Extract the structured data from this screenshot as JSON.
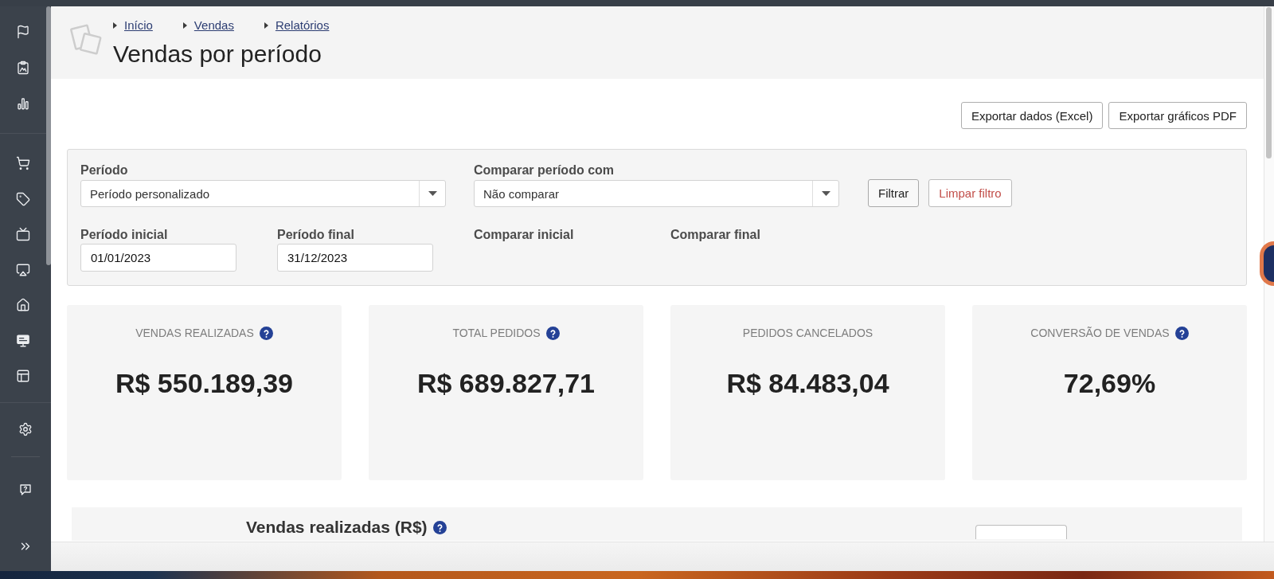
{
  "breadcrumbs": [
    {
      "label": "Início"
    },
    {
      "label": "Vendas"
    },
    {
      "label": "Relatórios"
    }
  ],
  "page": {
    "title": "Vendas por período"
  },
  "actions": [
    {
      "label": "Exportar dados (Excel)"
    },
    {
      "label": "Exportar gráficos PDF"
    }
  ],
  "filters": {
    "selects": [
      {
        "label": "Período",
        "value": "Período personalizado"
      },
      {
        "label": "Comparar período com",
        "value": "Não comparar"
      }
    ],
    "buttons": [
      {
        "label": "Filtrar",
        "kind": "default"
      },
      {
        "label": "Limpar filtro",
        "kind": "danger"
      }
    ],
    "dates": [
      {
        "label": "Período inicial",
        "value": "01/01/2023"
      },
      {
        "label": "Período final",
        "value": "31/12/2023"
      },
      {
        "label": "Comparar inicial"
      },
      {
        "label": "Comparar final"
      }
    ]
  },
  "stats": [
    {
      "label": "VENDAS REALIZADAS",
      "value": "R$ 550.189,39",
      "help": true
    },
    {
      "label": "TOTAL PEDIDOS",
      "value": "R$ 689.827,71",
      "help": true
    },
    {
      "label": "PEDIDOS CANCELADOS",
      "value": "R$ 84.483,04",
      "help": false
    },
    {
      "label": "CONVERSÃO DE VENDAS",
      "value": "72,69%",
      "help": true
    }
  ],
  "chart_panel": {
    "title": "Vendas realizadas (R$)",
    "help": true
  }
}
